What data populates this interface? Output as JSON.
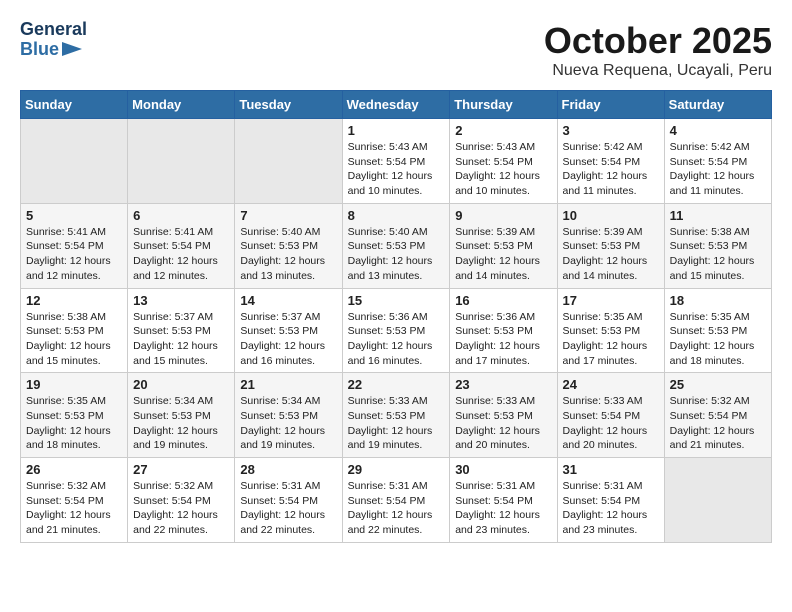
{
  "logo": {
    "text_general": "General",
    "text_blue": "Blue"
  },
  "header": {
    "month": "October 2025",
    "location": "Nueva Requena, Ucayali, Peru"
  },
  "days_header": [
    "Sunday",
    "Monday",
    "Tuesday",
    "Wednesday",
    "Thursday",
    "Friday",
    "Saturday"
  ],
  "weeks": [
    [
      {
        "num": "",
        "sunrise": "",
        "sunset": "",
        "daylight": "",
        "empty": true
      },
      {
        "num": "",
        "sunrise": "",
        "sunset": "",
        "daylight": "",
        "empty": true
      },
      {
        "num": "",
        "sunrise": "",
        "sunset": "",
        "daylight": "",
        "empty": true
      },
      {
        "num": "1",
        "sunrise": "Sunrise: 5:43 AM",
        "sunset": "Sunset: 5:54 PM",
        "daylight": "Daylight: 12 hours and 10 minutes.",
        "empty": false
      },
      {
        "num": "2",
        "sunrise": "Sunrise: 5:43 AM",
        "sunset": "Sunset: 5:54 PM",
        "daylight": "Daylight: 12 hours and 10 minutes.",
        "empty": false
      },
      {
        "num": "3",
        "sunrise": "Sunrise: 5:42 AM",
        "sunset": "Sunset: 5:54 PM",
        "daylight": "Daylight: 12 hours and 11 minutes.",
        "empty": false
      },
      {
        "num": "4",
        "sunrise": "Sunrise: 5:42 AM",
        "sunset": "Sunset: 5:54 PM",
        "daylight": "Daylight: 12 hours and 11 minutes.",
        "empty": false
      }
    ],
    [
      {
        "num": "5",
        "sunrise": "Sunrise: 5:41 AM",
        "sunset": "Sunset: 5:54 PM",
        "daylight": "Daylight: 12 hours and 12 minutes.",
        "empty": false
      },
      {
        "num": "6",
        "sunrise": "Sunrise: 5:41 AM",
        "sunset": "Sunset: 5:54 PM",
        "daylight": "Daylight: 12 hours and 12 minutes.",
        "empty": false
      },
      {
        "num": "7",
        "sunrise": "Sunrise: 5:40 AM",
        "sunset": "Sunset: 5:53 PM",
        "daylight": "Daylight: 12 hours and 13 minutes.",
        "empty": false
      },
      {
        "num": "8",
        "sunrise": "Sunrise: 5:40 AM",
        "sunset": "Sunset: 5:53 PM",
        "daylight": "Daylight: 12 hours and 13 minutes.",
        "empty": false
      },
      {
        "num": "9",
        "sunrise": "Sunrise: 5:39 AM",
        "sunset": "Sunset: 5:53 PM",
        "daylight": "Daylight: 12 hours and 14 minutes.",
        "empty": false
      },
      {
        "num": "10",
        "sunrise": "Sunrise: 5:39 AM",
        "sunset": "Sunset: 5:53 PM",
        "daylight": "Daylight: 12 hours and 14 minutes.",
        "empty": false
      },
      {
        "num": "11",
        "sunrise": "Sunrise: 5:38 AM",
        "sunset": "Sunset: 5:53 PM",
        "daylight": "Daylight: 12 hours and 15 minutes.",
        "empty": false
      }
    ],
    [
      {
        "num": "12",
        "sunrise": "Sunrise: 5:38 AM",
        "sunset": "Sunset: 5:53 PM",
        "daylight": "Daylight: 12 hours and 15 minutes.",
        "empty": false
      },
      {
        "num": "13",
        "sunrise": "Sunrise: 5:37 AM",
        "sunset": "Sunset: 5:53 PM",
        "daylight": "Daylight: 12 hours and 15 minutes.",
        "empty": false
      },
      {
        "num": "14",
        "sunrise": "Sunrise: 5:37 AM",
        "sunset": "Sunset: 5:53 PM",
        "daylight": "Daylight: 12 hours and 16 minutes.",
        "empty": false
      },
      {
        "num": "15",
        "sunrise": "Sunrise: 5:36 AM",
        "sunset": "Sunset: 5:53 PM",
        "daylight": "Daylight: 12 hours and 16 minutes.",
        "empty": false
      },
      {
        "num": "16",
        "sunrise": "Sunrise: 5:36 AM",
        "sunset": "Sunset: 5:53 PM",
        "daylight": "Daylight: 12 hours and 17 minutes.",
        "empty": false
      },
      {
        "num": "17",
        "sunrise": "Sunrise: 5:35 AM",
        "sunset": "Sunset: 5:53 PM",
        "daylight": "Daylight: 12 hours and 17 minutes.",
        "empty": false
      },
      {
        "num": "18",
        "sunrise": "Sunrise: 5:35 AM",
        "sunset": "Sunset: 5:53 PM",
        "daylight": "Daylight: 12 hours and 18 minutes.",
        "empty": false
      }
    ],
    [
      {
        "num": "19",
        "sunrise": "Sunrise: 5:35 AM",
        "sunset": "Sunset: 5:53 PM",
        "daylight": "Daylight: 12 hours and 18 minutes.",
        "empty": false
      },
      {
        "num": "20",
        "sunrise": "Sunrise: 5:34 AM",
        "sunset": "Sunset: 5:53 PM",
        "daylight": "Daylight: 12 hours and 19 minutes.",
        "empty": false
      },
      {
        "num": "21",
        "sunrise": "Sunrise: 5:34 AM",
        "sunset": "Sunset: 5:53 PM",
        "daylight": "Daylight: 12 hours and 19 minutes.",
        "empty": false
      },
      {
        "num": "22",
        "sunrise": "Sunrise: 5:33 AM",
        "sunset": "Sunset: 5:53 PM",
        "daylight": "Daylight: 12 hours and 19 minutes.",
        "empty": false
      },
      {
        "num": "23",
        "sunrise": "Sunrise: 5:33 AM",
        "sunset": "Sunset: 5:53 PM",
        "daylight": "Daylight: 12 hours and 20 minutes.",
        "empty": false
      },
      {
        "num": "24",
        "sunrise": "Sunrise: 5:33 AM",
        "sunset": "Sunset: 5:54 PM",
        "daylight": "Daylight: 12 hours and 20 minutes.",
        "empty": false
      },
      {
        "num": "25",
        "sunrise": "Sunrise: 5:32 AM",
        "sunset": "Sunset: 5:54 PM",
        "daylight": "Daylight: 12 hours and 21 minutes.",
        "empty": false
      }
    ],
    [
      {
        "num": "26",
        "sunrise": "Sunrise: 5:32 AM",
        "sunset": "Sunset: 5:54 PM",
        "daylight": "Daylight: 12 hours and 21 minutes.",
        "empty": false
      },
      {
        "num": "27",
        "sunrise": "Sunrise: 5:32 AM",
        "sunset": "Sunset: 5:54 PM",
        "daylight": "Daylight: 12 hours and 22 minutes.",
        "empty": false
      },
      {
        "num": "28",
        "sunrise": "Sunrise: 5:31 AM",
        "sunset": "Sunset: 5:54 PM",
        "daylight": "Daylight: 12 hours and 22 minutes.",
        "empty": false
      },
      {
        "num": "29",
        "sunrise": "Sunrise: 5:31 AM",
        "sunset": "Sunset: 5:54 PM",
        "daylight": "Daylight: 12 hours and 22 minutes.",
        "empty": false
      },
      {
        "num": "30",
        "sunrise": "Sunrise: 5:31 AM",
        "sunset": "Sunset: 5:54 PM",
        "daylight": "Daylight: 12 hours and 23 minutes.",
        "empty": false
      },
      {
        "num": "31",
        "sunrise": "Sunrise: 5:31 AM",
        "sunset": "Sunset: 5:54 PM",
        "daylight": "Daylight: 12 hours and 23 minutes.",
        "empty": false
      },
      {
        "num": "",
        "sunrise": "",
        "sunset": "",
        "daylight": "",
        "empty": true
      }
    ]
  ]
}
